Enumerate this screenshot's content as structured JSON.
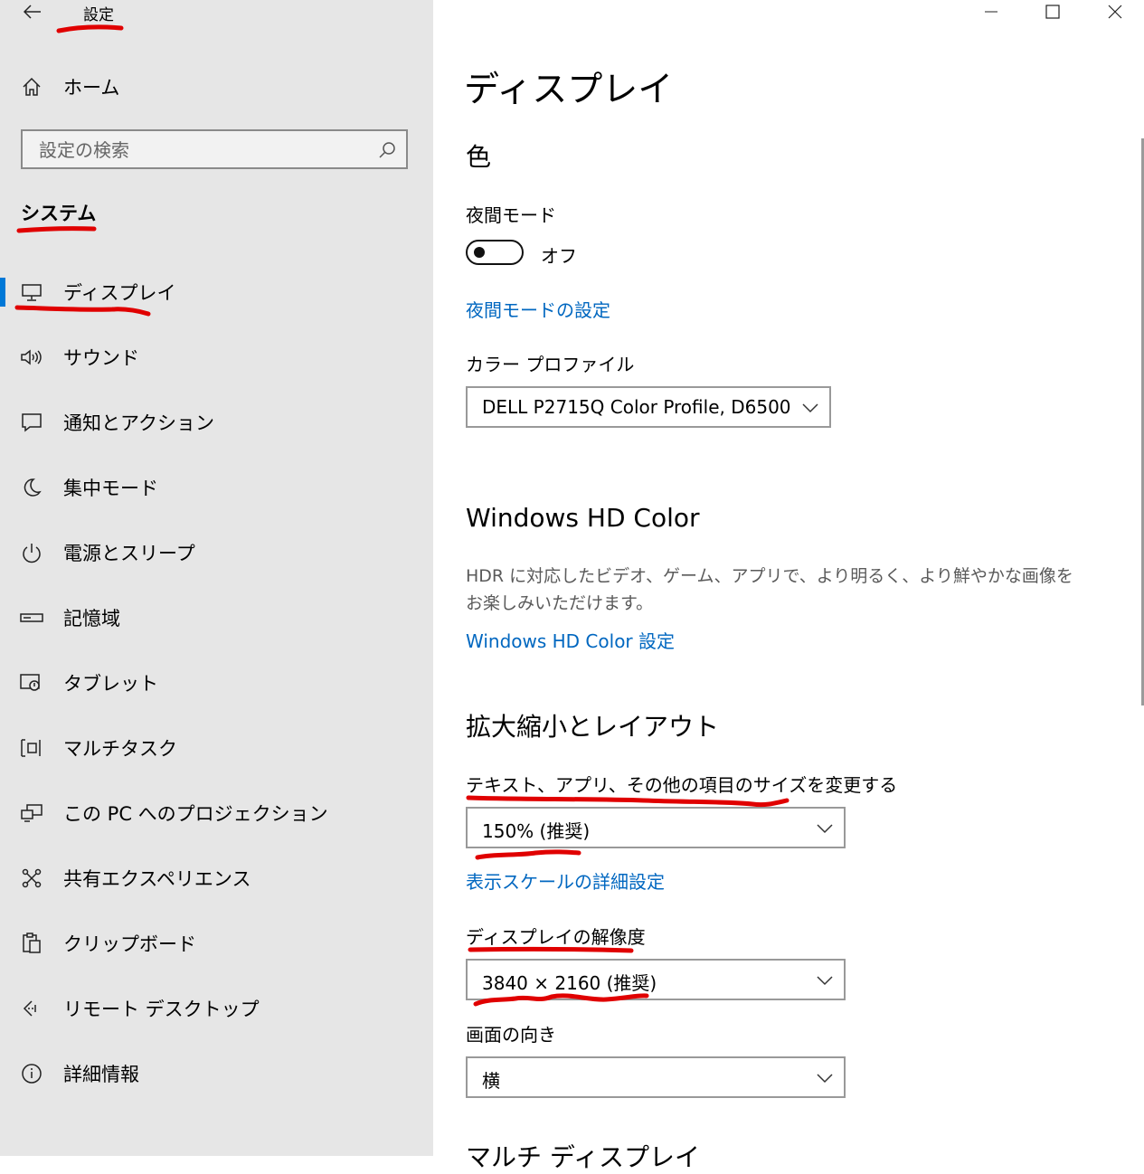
{
  "window": {
    "title": "設定",
    "controls": [
      "minimize-icon",
      "maximize-icon",
      "close-icon"
    ]
  },
  "sidebar": {
    "home_label": "ホーム",
    "search_placeholder": "設定の検索",
    "section_title": "システム",
    "items": [
      {
        "label": "ディスプレイ",
        "icon": "monitor-icon",
        "selected": true
      },
      {
        "label": "サウンド",
        "icon": "speaker-icon"
      },
      {
        "label": "通知とアクション",
        "icon": "notification-icon"
      },
      {
        "label": "集中モード",
        "icon": "moon-icon"
      },
      {
        "label": "電源とスリープ",
        "icon": "power-icon"
      },
      {
        "label": "記憶域",
        "icon": "storage-icon"
      },
      {
        "label": "タブレット",
        "icon": "tablet-icon"
      },
      {
        "label": "マルチタスク",
        "icon": "multitask-icon"
      },
      {
        "label": "この PC へのプロジェクション",
        "icon": "projection-icon"
      },
      {
        "label": "共有エクスペリエンス",
        "icon": "shared-icon"
      },
      {
        "label": "クリップボード",
        "icon": "clipboard-icon"
      },
      {
        "label": "リモート デスクトップ",
        "icon": "remote-desktop-icon"
      },
      {
        "label": "詳細情報",
        "icon": "info-icon"
      }
    ]
  },
  "main": {
    "page_title": "ディスプレイ",
    "color": {
      "heading": "色",
      "night_mode_label": "夜間モード",
      "night_mode_state": "オフ",
      "night_mode_link": "夜間モードの設定",
      "color_profile_label": "カラー プロファイル",
      "color_profile_value": "DELL P2715Q Color Profile, D6500"
    },
    "hd_color": {
      "heading": "Windows HD Color",
      "description": "HDR に対応したビデオ、ゲーム、アプリで、より明るく、より鮮やかな画像をお楽しみいただけます。",
      "link": "Windows HD Color 設定"
    },
    "scale_layout": {
      "heading": "拡大縮小とレイアウト",
      "scale_label": "テキスト、アプリ、その他の項目のサイズを変更する",
      "scale_value": "150% (推奨)",
      "scale_link": "表示スケールの詳細設定",
      "resolution_label": "ディスプレイの解像度",
      "resolution_value": "3840 × 2160 (推奨)",
      "orientation_label": "画面の向き",
      "orientation_value": "横"
    },
    "multi_display_heading": "マルチ ディスプレイ"
  },
  "colors": {
    "accent": "#0078d7",
    "link": "#0067c0",
    "annotation": "#e00000",
    "sidebar_bg": "#e6e6e6"
  }
}
